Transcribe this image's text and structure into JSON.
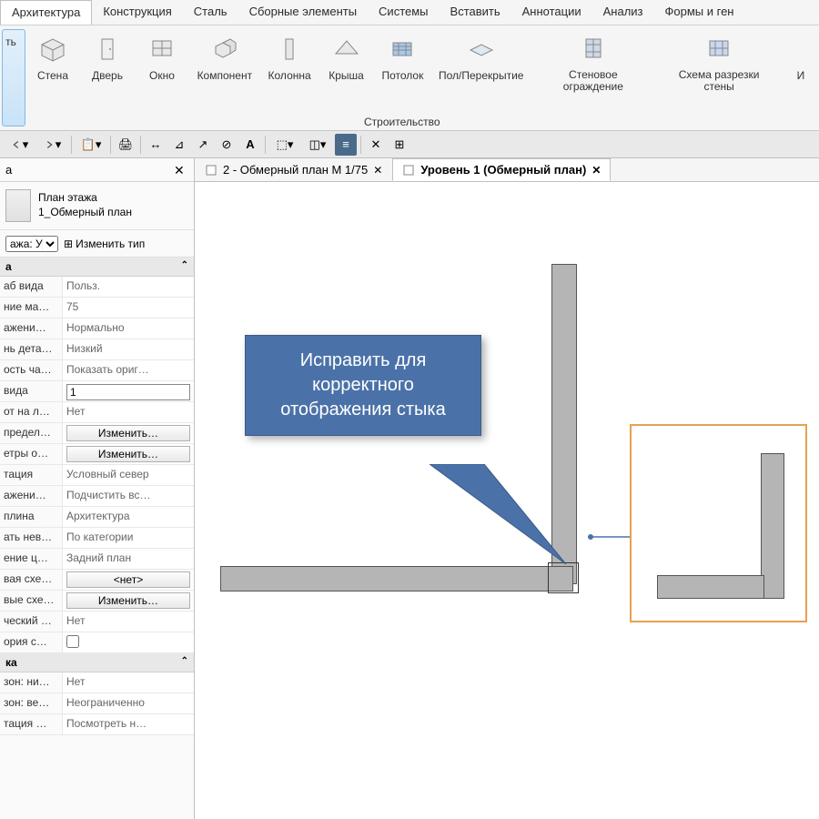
{
  "menu": {
    "items": [
      "Архитектура",
      "Конструкция",
      "Сталь",
      "Сборные элементы",
      "Системы",
      "Вставить",
      "Аннотации",
      "Анализ",
      "Формы и ген"
    ],
    "activeIndex": 0
  },
  "ribbon": {
    "first_label": "ть",
    "buttons": [
      {
        "label": "Стена"
      },
      {
        "label": "Дверь"
      },
      {
        "label": "Окно"
      },
      {
        "label": "Компонент"
      },
      {
        "label": "Колонна"
      },
      {
        "label": "Крыша"
      },
      {
        "label": "Потолок"
      },
      {
        "label": "Пол/Перекрытие"
      },
      {
        "label": "Стеновое ограждение"
      },
      {
        "label": "Схема разрезки стены"
      },
      {
        "label": "И"
      }
    ],
    "panel_label": "Строительство"
  },
  "tabs": [
    {
      "label": "2 - Обмерный план М 1/75",
      "active": false
    },
    {
      "label": "Уровень 1 (Обмерный план)",
      "active": true
    }
  ],
  "properties": {
    "header": "а",
    "type_line1": "План этажа",
    "type_line2": "1_Обмерный план",
    "filter_label": "ажа: Урс",
    "edit_type_label": "Изменить тип",
    "section1": "а",
    "rows": [
      {
        "label": "аб вида",
        "value": "Польз."
      },
      {
        "label": "ние ма…",
        "value": "75"
      },
      {
        "label": "ажени…",
        "value": "Нормально"
      },
      {
        "label": "нь дета…",
        "value": "Низкий"
      },
      {
        "label": "ость ча…",
        "value": "Показать ориг…"
      },
      {
        "label": " вида",
        "value": "1",
        "input": true
      },
      {
        "label": "от на л…",
        "value": "Нет"
      },
      {
        "label": "предел…",
        "value": "Изменить…",
        "button": true
      },
      {
        "label": "етры о…",
        "value": "Изменить…",
        "button": true
      },
      {
        "label": "тация",
        "value": "Условный север"
      },
      {
        "label": "ажени…",
        "value": "Подчистить вс…"
      },
      {
        "label": "плина",
        "value": "Архитектура"
      },
      {
        "label": "ать нев…",
        "value": "По категории"
      },
      {
        "label": "ение ц…",
        "value": "Задний план"
      },
      {
        "label": "вая схе…",
        "value": "<нет>",
        "button": true
      },
      {
        "label": "вые схе…",
        "value": "Изменить…",
        "button": true
      },
      {
        "label": "ческий …",
        "value": "Нет"
      },
      {
        "label": "ория с…",
        "value": "",
        "checkbox": true
      }
    ],
    "section2": "ка",
    "rows2": [
      {
        "label": "зон: ни…",
        "value": "Нет"
      },
      {
        "label": "зон: ве…",
        "value": "Неограниченно"
      },
      {
        "label": "тация …",
        "value": "Посмотреть н…"
      }
    ]
  },
  "callout": {
    "text": "Исправить для корректного отображения стыка"
  }
}
